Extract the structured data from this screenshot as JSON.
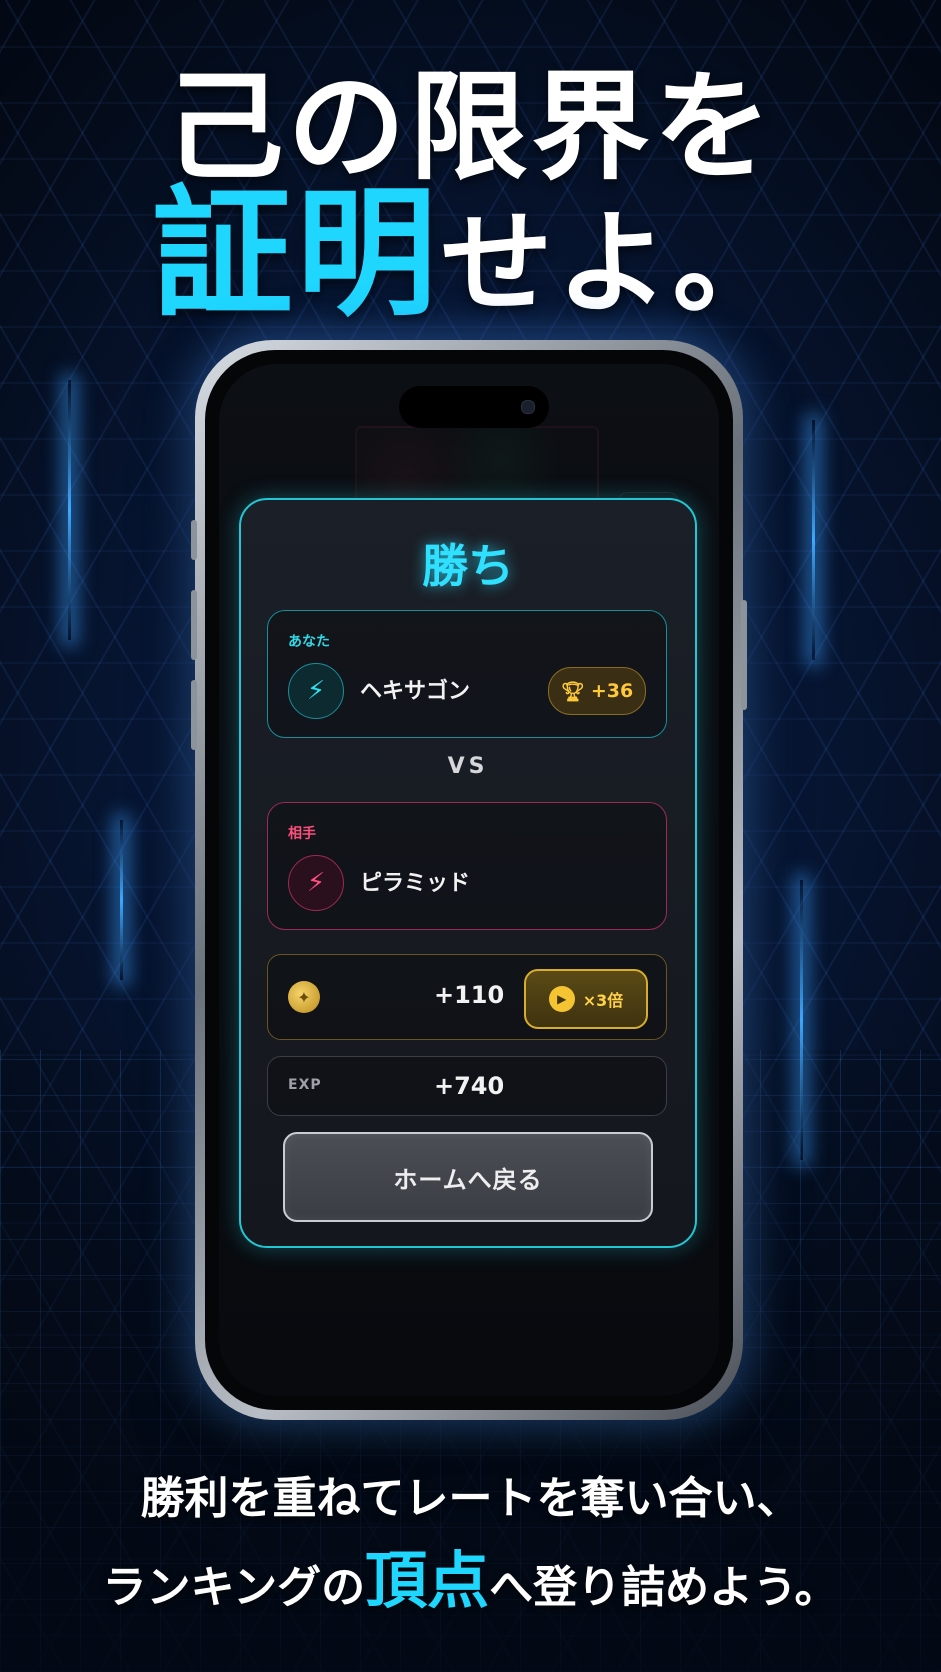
{
  "headline": {
    "line1": "己の限界を",
    "line2_accent": "証明",
    "line2_rest": "せよ。"
  },
  "result": {
    "title": "勝ち",
    "player": {
      "label": "あなた",
      "name": "ヘキサゴン",
      "trophy_delta": "+36",
      "avatar_icon": "lightning-icon"
    },
    "vs": "VS",
    "opponent": {
      "label": "相手",
      "name": "ピラミッド",
      "avatar_icon": "lightning-icon"
    },
    "coins": {
      "value": "+110",
      "ad_multiplier": "×3倍"
    },
    "exp": {
      "label": "EXP",
      "value": "+740"
    },
    "home_button": "ホームへ戻る"
  },
  "footer": {
    "line1": "勝利を重ねてレートを奪い合い、",
    "line2_before": "ランキングの",
    "line2_accent": "頂点",
    "line2_after": "へ登り詰めよう。"
  },
  "colors": {
    "accent_cyan": "#1fd6ff",
    "opponent_pink": "#ff4f7e",
    "gold": "#ffc93a"
  }
}
